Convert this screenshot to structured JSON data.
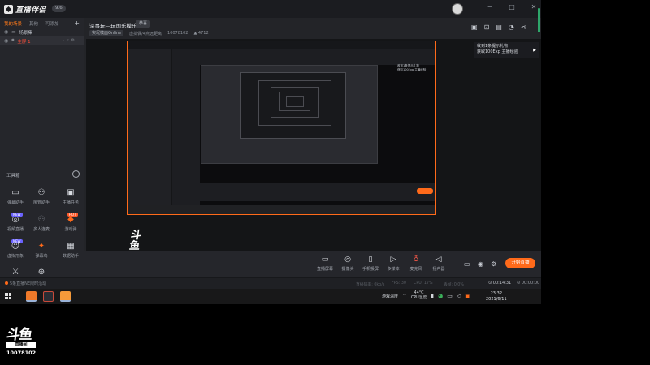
{
  "app": {
    "logo_text": "直播伴侣",
    "version": "9.6",
    "window_controls": [
      "─",
      "□",
      "✕"
    ]
  },
  "room": {
    "title": "深事玩—玩国乐模乐",
    "tag": "恭喜",
    "status_pill": "实况模面Online",
    "category": "虚拟偶/4点远距离",
    "room_id": "10078102",
    "count": "4712"
  },
  "scene_tabs": {
    "items": [
      "我的场景",
      "其他",
      "可添加"
    ],
    "add": "+"
  },
  "scenes": [
    {
      "label": "场景集",
      "selected": false
    },
    {
      "label": "主屏 1",
      "selected": true
    }
  ],
  "tools": {
    "title": "工具箱",
    "items": [
      {
        "name": "弹幕助手",
        "icon": "monitor-icon",
        "badge": ""
      },
      {
        "name": "房管助手",
        "icon": "user-icon",
        "badge": ""
      },
      {
        "name": "主播任务",
        "icon": "task-icon",
        "badge": ""
      },
      {
        "name": "视频直播",
        "icon": "video-icon",
        "badge": "NEW"
      },
      {
        "name": "多人连麦",
        "icon": "group-icon",
        "badge": ""
      },
      {
        "name": "游戏弹",
        "icon": "game-icon",
        "badge": "HOT"
      },
      {
        "name": "虚拟形象",
        "icon": "avatar-icon",
        "badge": "NEW"
      },
      {
        "name": "弹幕鸡",
        "icon": "barrage-icon",
        "badge": ""
      },
      {
        "name": "数据助手",
        "icon": "data-icon",
        "badge": ""
      },
      {
        "name": "PK",
        "icon": "pk-icon",
        "badge": ""
      },
      {
        "name": "直播插件",
        "icon": "plugin-icon",
        "badge": ""
      }
    ]
  },
  "notice": {
    "line1": "收到1条提示礼物",
    "line2": "获取100Exp 主播经验"
  },
  "bottom_toolbar": {
    "items": [
      "直播屏幕",
      "摄像头",
      "手机投屏",
      "多媒体",
      "麦克风",
      "扬声器"
    ],
    "start_button": "开始直播"
  },
  "status": {
    "message": "5条直播NE限时活动",
    "stats": [
      "直播码率: 0kb/s",
      "FPS: 30",
      "CPU: 17%",
      "丢帧: 0.0%"
    ],
    "live_time": "00:14:31",
    "rec_time": "00:00:00"
  },
  "taskbar": {
    "weather": "44°C",
    "weather_sub": "CPU温度",
    "tray_label": "游戏温度",
    "time": "23:32",
    "date": "2021/6/11"
  },
  "watermark": {
    "glyph": "斗鱼",
    "sub": "直播间",
    "room_id": "10078102"
  }
}
